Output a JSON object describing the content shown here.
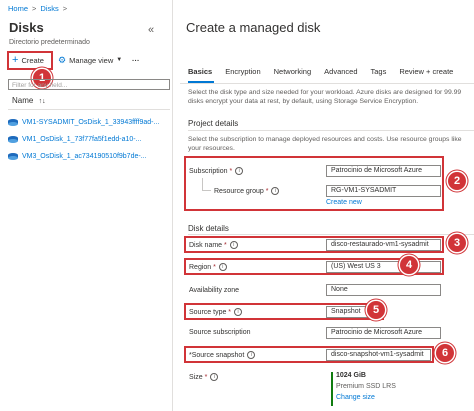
{
  "breadcrumb": [
    "Home",
    "Disks"
  ],
  "left": {
    "title": "Disks",
    "subtitle": "Directorio predeterminado",
    "commands": {
      "create": "Create",
      "manage_view": "Manage view",
      "more": "···"
    },
    "filter_placeholder": "Filter for any field...",
    "column_header": "Name",
    "sort_glyph": "↑↓",
    "disks": [
      "VM1-SYSADMIT_OsDisk_1_33943ffff9ad-...",
      "VM1_OsDisk_1_73f77fa5f1edd-a10-...",
      "VM3_OsDisk_1_ac734190510f9b7de-..."
    ]
  },
  "main": {
    "title": "Create a managed disk",
    "tabs": [
      "Basics",
      "Encryption",
      "Networking",
      "Advanced",
      "Tags",
      "Review + create"
    ],
    "intro": "Select the disk type and size needed for your workload. Azure disks are designed for 99.99 disks encrypt your data at rest, by default, using Storage Service Encryption.",
    "project_details": {
      "heading": "Project details",
      "desc": "Select the subscription to manage deployed resources and costs. Use resource groups like your resources.",
      "subscription_label": "Subscription",
      "subscription_value": "Patrocinio de Microsoft Azure",
      "resource_group_label": "Resource group",
      "resource_group_value": "RG-VM1-SYSADMIT",
      "create_new": "Create new"
    },
    "disk_details": {
      "heading": "Disk details",
      "disk_name_label": "Disk name",
      "disk_name_value": "disco-restaurado-vm1-sysadmit",
      "region_label": "Region",
      "region_value": "(US) West US 3",
      "availability_zone_label": "Availability zone",
      "availability_zone_value": "None",
      "source_type_label": "Source type",
      "source_type_value": "Snapshot",
      "source_subscription_label": "Source subscription",
      "source_subscription_value": "Patrocinio de Microsoft Azure",
      "source_snapshot_label": "*Source snapshot",
      "source_snapshot_value": "disco-snapshot-vm1-sysadmit",
      "size_label": "Size",
      "size_value": "1024 GiB",
      "size_tier": "Premium SSD LRS",
      "change_size": "Change size"
    }
  },
  "badges": [
    "1",
    "2",
    "3",
    "4",
    "5",
    "6"
  ],
  "colors": {
    "accent": "#0078d4",
    "highlight": "#d13438"
  }
}
